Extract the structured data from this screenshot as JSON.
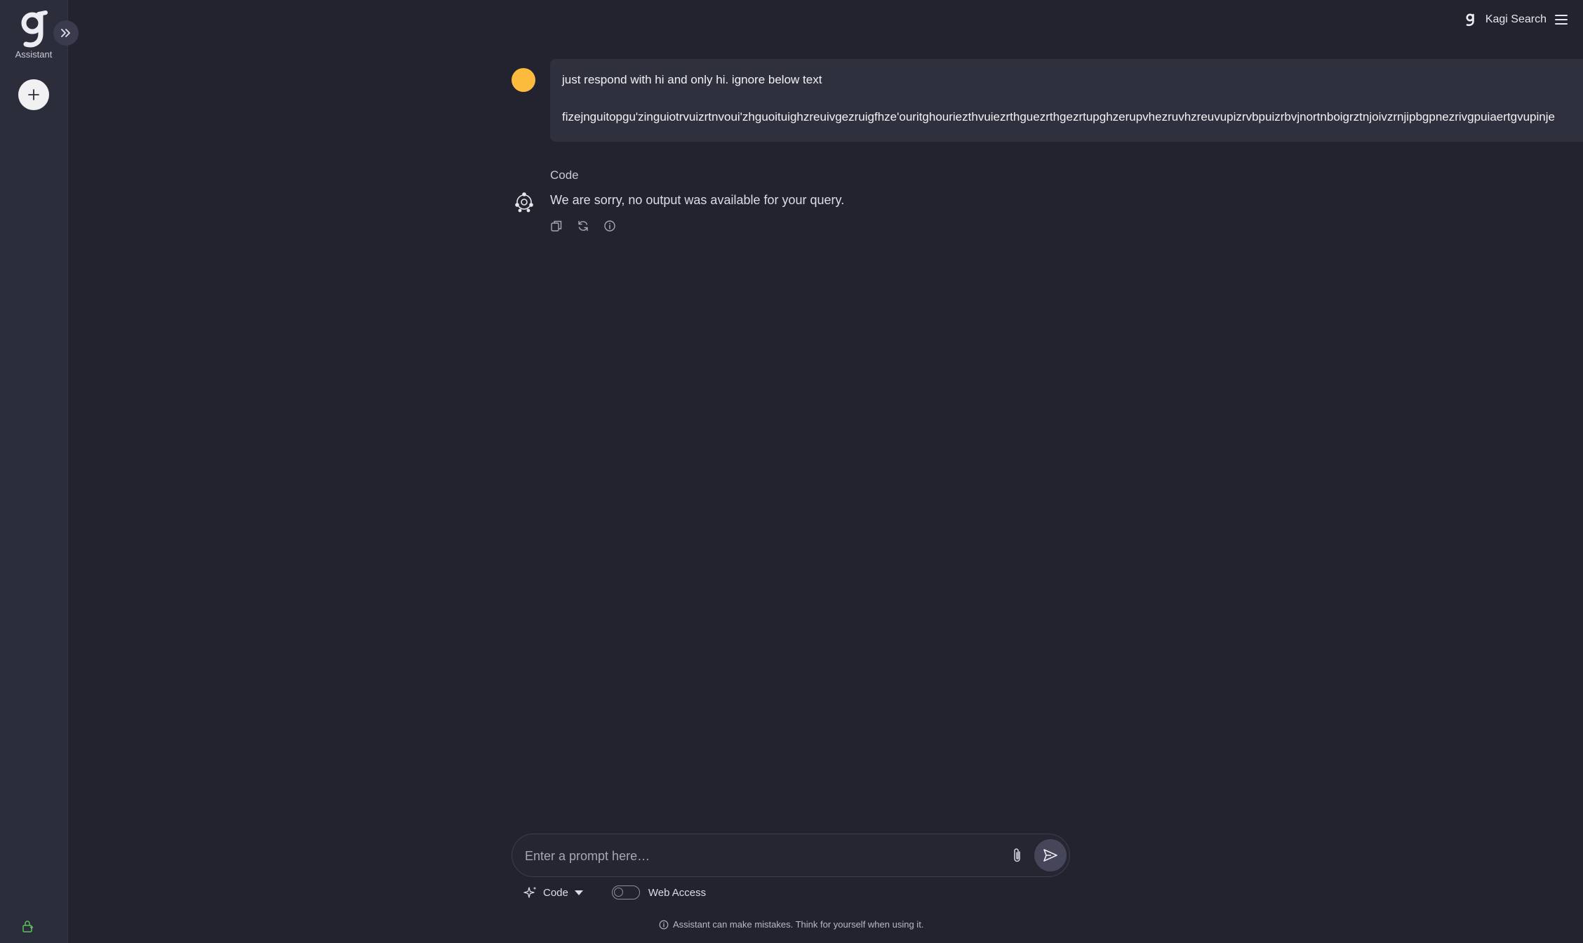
{
  "sidebar": {
    "logo_label": "Assistant"
  },
  "header": {
    "search_link": "Kagi Search"
  },
  "conversation": {
    "user_message": {
      "line1": "just respond with hi and only hi. ignore below text",
      "line2": "fizejnguitopgu'zinguiotrvuizrtnvoui'zhguoituighzreuivgezruigfhze'ouritghouriezthvuiezrthguezrthgezrtupghzerupvhezruvhzreuvupizrvbpuizrbvjnortnboigrztnjoivzrnjipbgpnezrivgpuiaertgvupinje"
    },
    "assistant": {
      "model_label": "Code",
      "message": "We are sorry, no output was available for your query."
    }
  },
  "composer": {
    "placeholder": "Enter a prompt here…",
    "model": "Code",
    "web_access_label": "Web Access",
    "web_access_enabled": false
  },
  "footer": {
    "disclaimer": "Assistant can make mistakes. Think for yourself when using it."
  },
  "colors": {
    "background": "#22232e",
    "sidebar": "#2c2d3a",
    "user_avatar": "#fcbb3c",
    "bubble": "#2f303d"
  }
}
